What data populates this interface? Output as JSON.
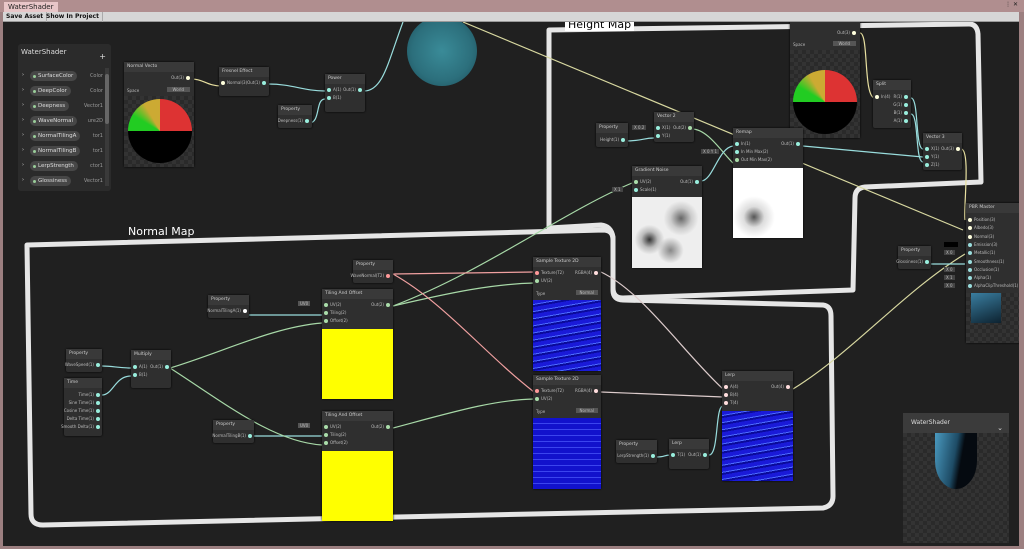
{
  "window": {
    "tab": "WaterShader",
    "toolbar": {
      "save_asset": "Save Asset",
      "show_in_project": "Show In Project"
    }
  },
  "groups": {
    "height_map": "Height Map",
    "normal_map": "Normal Map"
  },
  "blackboard": {
    "title": "WaterShader",
    "add": "+",
    "properties": [
      {
        "name": "SurfaceColor",
        "type": "Color"
      },
      {
        "name": "DeepColor",
        "type": "Color"
      },
      {
        "name": "Deepness",
        "type": "Vector1"
      },
      {
        "name": "WaveNormal",
        "type": "ure2D"
      },
      {
        "name": "NormalTilingA",
        "type": "tor1"
      },
      {
        "name": "NormalTilingB",
        "type": "tor1"
      },
      {
        "name": "LerpStrength",
        "type": "ctor1"
      },
      {
        "name": "Glossiness",
        "type": "Vector1"
      }
    ]
  },
  "nodes": {
    "normal_vector": {
      "title": "Normal Vecto",
      "out": "Out(3)",
      "space_label": "Space",
      "space_value": "World"
    },
    "normal_vector2": {
      "out": "Out(3)",
      "space_label": "Space",
      "space_value": "World"
    },
    "fresnel": {
      "title": "Fresnel Effect",
      "in": "Normal(3)",
      "out": "Out(1)"
    },
    "power": {
      "title": "Power",
      "a": "A(1)",
      "b": "B(1)",
      "out": "Out(1)"
    },
    "prop_deepness": {
      "title": "Property",
      "out": "Deepness(1)"
    },
    "split": {
      "title": "Split",
      "in": "In(4)",
      "r": "R(1)",
      "g": "G(1)",
      "b": "B(1)",
      "a": "A(1)"
    },
    "vector3": {
      "title": "Vector 3",
      "x": "X(1)",
      "y": "Y(1)",
      "z": "Z(1)",
      "out": "Out(3)"
    },
    "prop_height": {
      "title": "Property",
      "out": "Height(1)"
    },
    "vector2": {
      "title": "Vector 2",
      "x_val": "X 0.2",
      "x": "X(1)",
      "y": "Y(1)",
      "out": "Out(2)"
    },
    "remap": {
      "title": "Remap",
      "in": "In(1)",
      "inminmax": "In Min Max(2)",
      "outminmax": "Out Min Max(2)",
      "inmm_val": "X 0   Y 1",
      "out": "Out(1)"
    },
    "gradient_noise": {
      "title": "Gradient Noise",
      "uv": "UV(2)",
      "scale": "Scale(1)",
      "scale_val": "X 1",
      "out": "Out(1)"
    },
    "pbr": {
      "title": "PBR Master",
      "inputs": [
        "Position(3)",
        "Albedo(3)",
        "Normal(3)",
        "Emission(3)",
        "Metallic(1)",
        "Smoothness(1)",
        "Occlusion(1)",
        "Alpha(1)",
        "AlphaClipThreshold(1)"
      ],
      "metallic_val": "X 0",
      "occlusion_val": "X 0",
      "alpha_val": "X 1",
      "clip_val": "X 0"
    },
    "prop_glossiness": {
      "title": "Property",
      "out": "Glossiness(1)"
    },
    "prop_wavenormal": {
      "title": "Property",
      "out": "WaveNormal(T2)"
    },
    "sample1": {
      "title": "Sample Texture 2D",
      "tex": "Texture(T2)",
      "uv": "UV(2)",
      "out": "RGBA(4)",
      "type_label": "Type",
      "type_value": "Normal"
    },
    "sample2": {
      "title": "Sample Texture 2D",
      "tex": "Texture(T2)",
      "uv": "UV(2)",
      "out": "RGBA(4)",
      "type_label": "Type",
      "type_value": "Normal"
    },
    "tiling1": {
      "title": "Tiling And Offset",
      "uv": "UV(2)",
      "uv_val": "UV0",
      "tiling": "Tiling(2)",
      "offset": "Offset(2)",
      "out": "Out(2)"
    },
    "tiling2": {
      "title": "Tiling And Offset",
      "uv": "UV(2)",
      "uv_val": "UV0",
      "tiling": "Tiling(2)",
      "offset": "Offset(2)",
      "out": "Out(2)"
    },
    "prop_tilinga": {
      "title": "Property",
      "out": "NormalTilingA(1)"
    },
    "prop_tilingb": {
      "title": "Property",
      "out": "NormalTilingB(1)"
    },
    "prop_wavespeed": {
      "title": "Property",
      "out": "WaveSpeed(1)"
    },
    "time": {
      "title": "Time",
      "outs": [
        "Time(1)",
        "Sine Time(1)",
        "Cosine Time(1)",
        "Delta Time(1)",
        "Smooth Delta(1)"
      ]
    },
    "multiply": {
      "title": "Multiply",
      "a": "A(1)",
      "b": "B(1)",
      "out": "Out(1)"
    },
    "prop_lerpstrength": {
      "title": "Property",
      "out": "LerpStrength(1)"
    },
    "lerp_small": {
      "title": "Lerp",
      "t": "T(1)",
      "out": "Out(1)"
    },
    "lerp_big": {
      "title": "Lerp",
      "a": "A(4)",
      "b": "B(4)",
      "t": "T(4)",
      "out": "Out(4)"
    }
  },
  "main_preview": {
    "title": "WaterShader"
  }
}
